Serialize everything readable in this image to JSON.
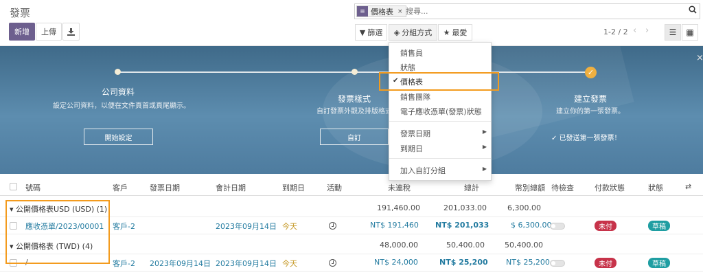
{
  "header": {
    "title": "發票",
    "new_label": "新增",
    "upload_label": "上傳",
    "download_icon": "download-icon"
  },
  "search": {
    "facet_label": "價格表",
    "facet_remove": "×",
    "placeholder": "搜尋..."
  },
  "filters": {
    "filter_label": "篩選",
    "group_label": "分組方式",
    "favorites_label": "最愛"
  },
  "pager": {
    "range": "1-2 / 2"
  },
  "onboarding": {
    "steps": [
      {
        "title": "公司資料",
        "desc": "設定公司資料，以便在文件頁首或頁尾顯示。",
        "button": "開始設定"
      },
      {
        "title": "發票樣式",
        "desc": "自訂發票外觀及排版格式",
        "button": "自訂"
      },
      {
        "title": "建立發票",
        "desc": "建立你的第一張發票。",
        "note": "已發送第一張發票！"
      }
    ]
  },
  "group_by_menu": {
    "items": [
      {
        "label": "銷售員"
      },
      {
        "label": "狀態"
      },
      {
        "label": "價格表",
        "selected": true
      },
      {
        "label": "銷售團隊"
      },
      {
        "label": "電子應收憑單(發票)狀態"
      },
      {
        "label": "發票日期"
      },
      {
        "label": "到期日"
      },
      {
        "label": "加入自訂分組"
      }
    ]
  },
  "table": {
    "columns": [
      "號碼",
      "客戶",
      "發票日期",
      "會計日期",
      "到期日",
      "活動",
      "未連稅",
      "總計",
      "幣別總額",
      "待檢查",
      "付款狀態",
      "狀態"
    ],
    "groups": [
      {
        "label": "公開價格表USD (USD) (1)",
        "untaxed": "191,460.00",
        "total": "201,033.00",
        "currency_total": "6,300.00",
        "row": {
          "number": "應收憑單/2023/00001",
          "customer": "客戶-2",
          "invoice_date": "",
          "accounting_date": "2023年09月14日",
          "due_date": "今天",
          "untaxed": "NT$ 191,460",
          "total": "NT$ 201,033",
          "currency_total": "$ 6,300.00",
          "payment_status": "未付",
          "status": "草稿"
        }
      },
      {
        "label": "公開價格表 (TWD) (4)",
        "untaxed": "48,000.00",
        "total": "50,400.00",
        "currency_total": "50,400.00",
        "row": {
          "number": "/",
          "customer": "客戶-2",
          "invoice_date": "2023年09月14日",
          "accounting_date": "2023年09月14日",
          "due_date": "今天",
          "untaxed": "NT$ 24,000",
          "total": "NT$ 25,200",
          "currency_total": "NT$ 25,200",
          "payment_status": "未付",
          "status": "草稿"
        }
      }
    ]
  },
  "colors": {
    "primary": "#6d5f8e",
    "link": "#237ba0",
    "due_today": "#c59824",
    "unpaid_badge": "#c7334a",
    "draft_badge": "#1f9ea2",
    "highlight": "#f39b1e",
    "banner": "#4e7c9f"
  }
}
